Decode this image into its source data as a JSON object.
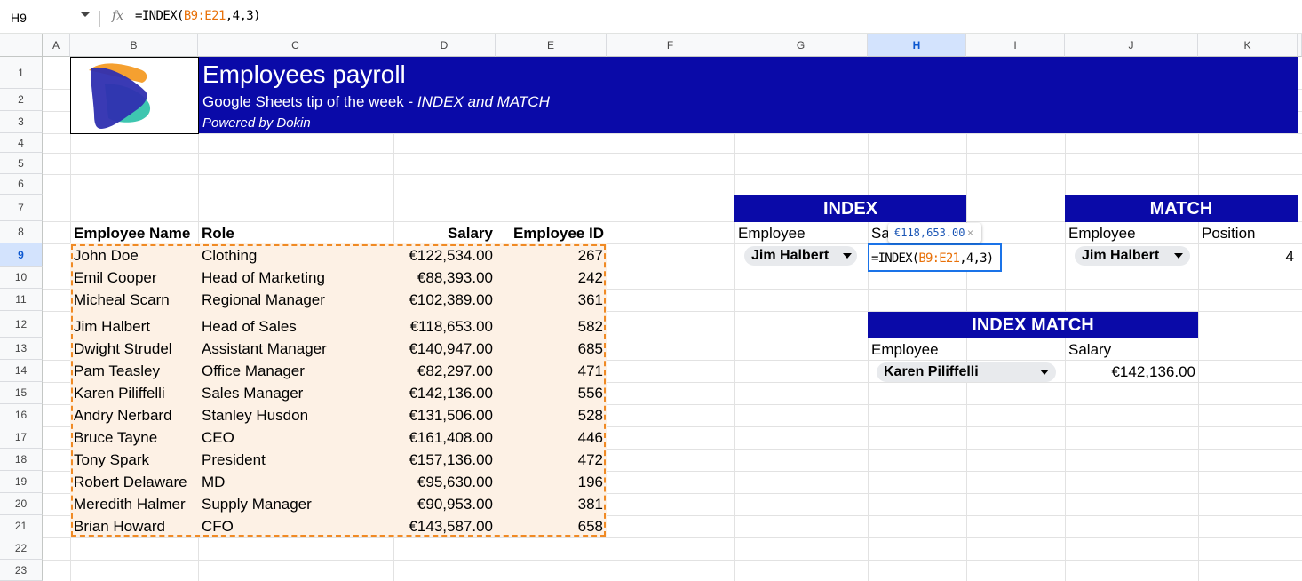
{
  "formula_bar": {
    "cell_ref": "H9",
    "fx": "fx",
    "formula_prefix": "=INDEX(",
    "formula_range": "B9:E21",
    "formula_suffix": ",4,3)"
  },
  "columns": [
    "A",
    "B",
    "C",
    "D",
    "E",
    "F",
    "G",
    "H",
    "I",
    "J",
    "K"
  ],
  "selected_column": "H",
  "rows": [
    "1",
    "2",
    "3",
    "4",
    "5",
    "6",
    "7",
    "8",
    "9",
    "10",
    "11",
    "12",
    "13",
    "14",
    "15",
    "16",
    "17",
    "18",
    "19",
    "20",
    "21",
    "22",
    "23"
  ],
  "selected_row": "9",
  "banner": {
    "title": "Employees payroll",
    "subtitle_plain": "Google Sheets tip of the week - ",
    "subtitle_italic": "INDEX and MATCH",
    "powered": "Powered by Dokin"
  },
  "table": {
    "headers": [
      "Employee Name",
      "Role",
      "Salary",
      "Employee ID"
    ],
    "rows": [
      [
        "John Doe",
        "Clothing",
        "€122,534.00",
        "267"
      ],
      [
        "Emil Cooper",
        "Head of Marketing",
        "€88,393.00",
        "242"
      ],
      [
        "Micheal Scarn",
        "Regional Manager",
        "€102,389.00",
        "361"
      ],
      [
        "Jim Halbert",
        "Head of Sales",
        "€118,653.00",
        "582"
      ],
      [
        "Dwight Strudel",
        "Assistant Manager",
        "€140,947.00",
        "685"
      ],
      [
        "Pam Teasley",
        "Office Manager",
        "€82,297.00",
        "471"
      ],
      [
        "Karen Piliffelli",
        "Sales Manager",
        "€142,136.00",
        "556"
      ],
      [
        "Andry Nerbard",
        "Stanley Husdon",
        "€131,506.00",
        "528"
      ],
      [
        "Bruce Tayne",
        "CEO",
        "€161,408.00",
        "446"
      ],
      [
        "Tony Spark",
        "President",
        "€157,136.00",
        "472"
      ],
      [
        "Robert Delaware",
        "MD",
        "€95,630.00",
        "196"
      ],
      [
        "Meredith Halmer",
        "Supply Manager",
        "€90,953.00",
        "381"
      ],
      [
        "Brian Howard",
        "CFO",
        "€143,587.00",
        "658"
      ]
    ]
  },
  "index_box": {
    "title": "INDEX",
    "employee_label": "Employee",
    "salary_label_partial": "Sa",
    "employee_value": "Jim Halbert",
    "active_prefix": "=INDEX(",
    "active_range": "B9:E21",
    "active_suffix": ",4,3)",
    "tooltip_value": "€118,653.00",
    "tooltip_close": "×"
  },
  "match_box": {
    "title": "MATCH",
    "employee_label": "Employee",
    "position_label": "Position",
    "employee_value": "Jim Halbert",
    "position_value": "4"
  },
  "index_match_box": {
    "title": "INDEX MATCH",
    "employee_label": "Employee",
    "salary_label": "Salary",
    "employee_value": "Karen Piliffelli",
    "salary_value": "€142,136.00"
  },
  "colors": {
    "banner": "#0a0aa8",
    "table_fill": "#fdf1e5",
    "range_border": "#f08a24",
    "selection": "#1a73e8"
  }
}
